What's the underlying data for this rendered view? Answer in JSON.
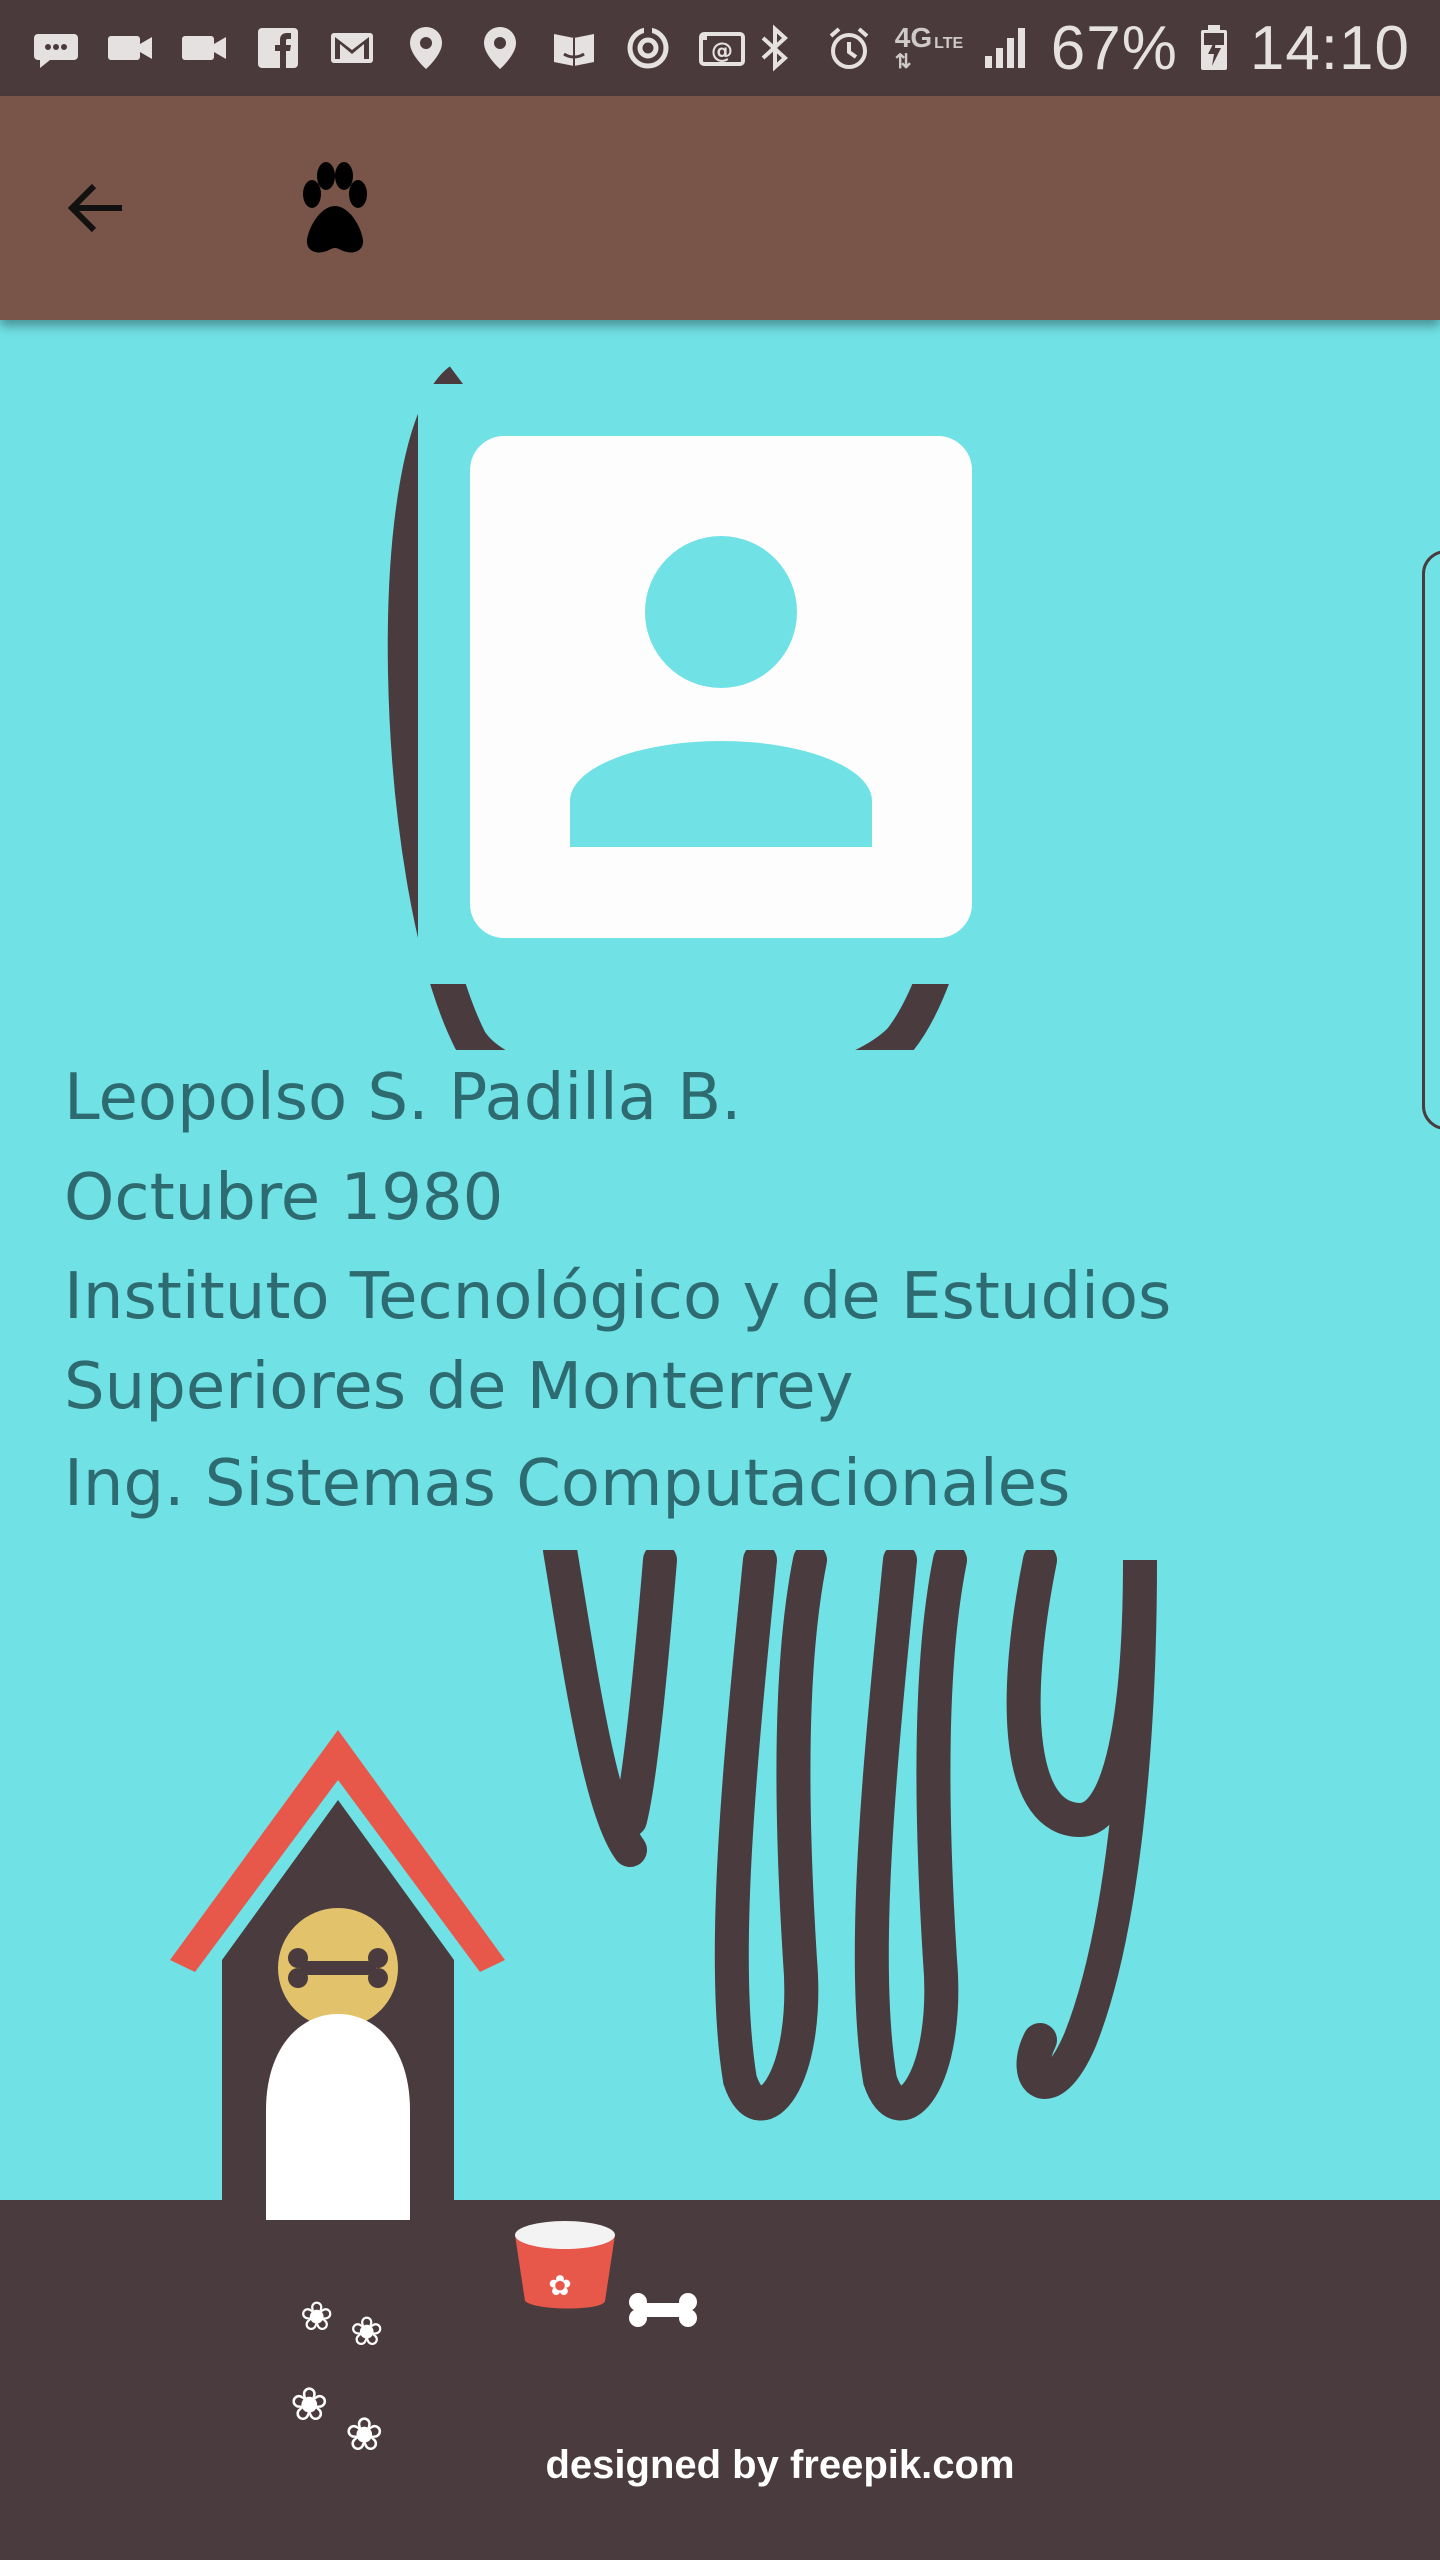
{
  "status_bar": {
    "battery": "67%",
    "time": "14:10",
    "network": "4G",
    "network_sub": "LTE"
  },
  "app_bar": {
    "back_icon": "arrow-back-icon",
    "logo_icon": "paw-icon"
  },
  "profile": {
    "avatar_icon": "person-placeholder-icon",
    "name": "Leopolso S. Padilla B.",
    "birth": "Octubre 1980",
    "school": "Instituto Tecnológico y de Estudios Superiores de Monterrey",
    "career": "Ing. Sistemas Computacionales"
  },
  "background": {
    "credit": "designed by  freepik.com"
  },
  "colors": {
    "status_bar": "#4b3a3c",
    "app_bar": "#785548",
    "background": "#70e1e5",
    "ground": "#4a3b3e",
    "text": "#2e6b70",
    "roof": "#e8584a"
  }
}
